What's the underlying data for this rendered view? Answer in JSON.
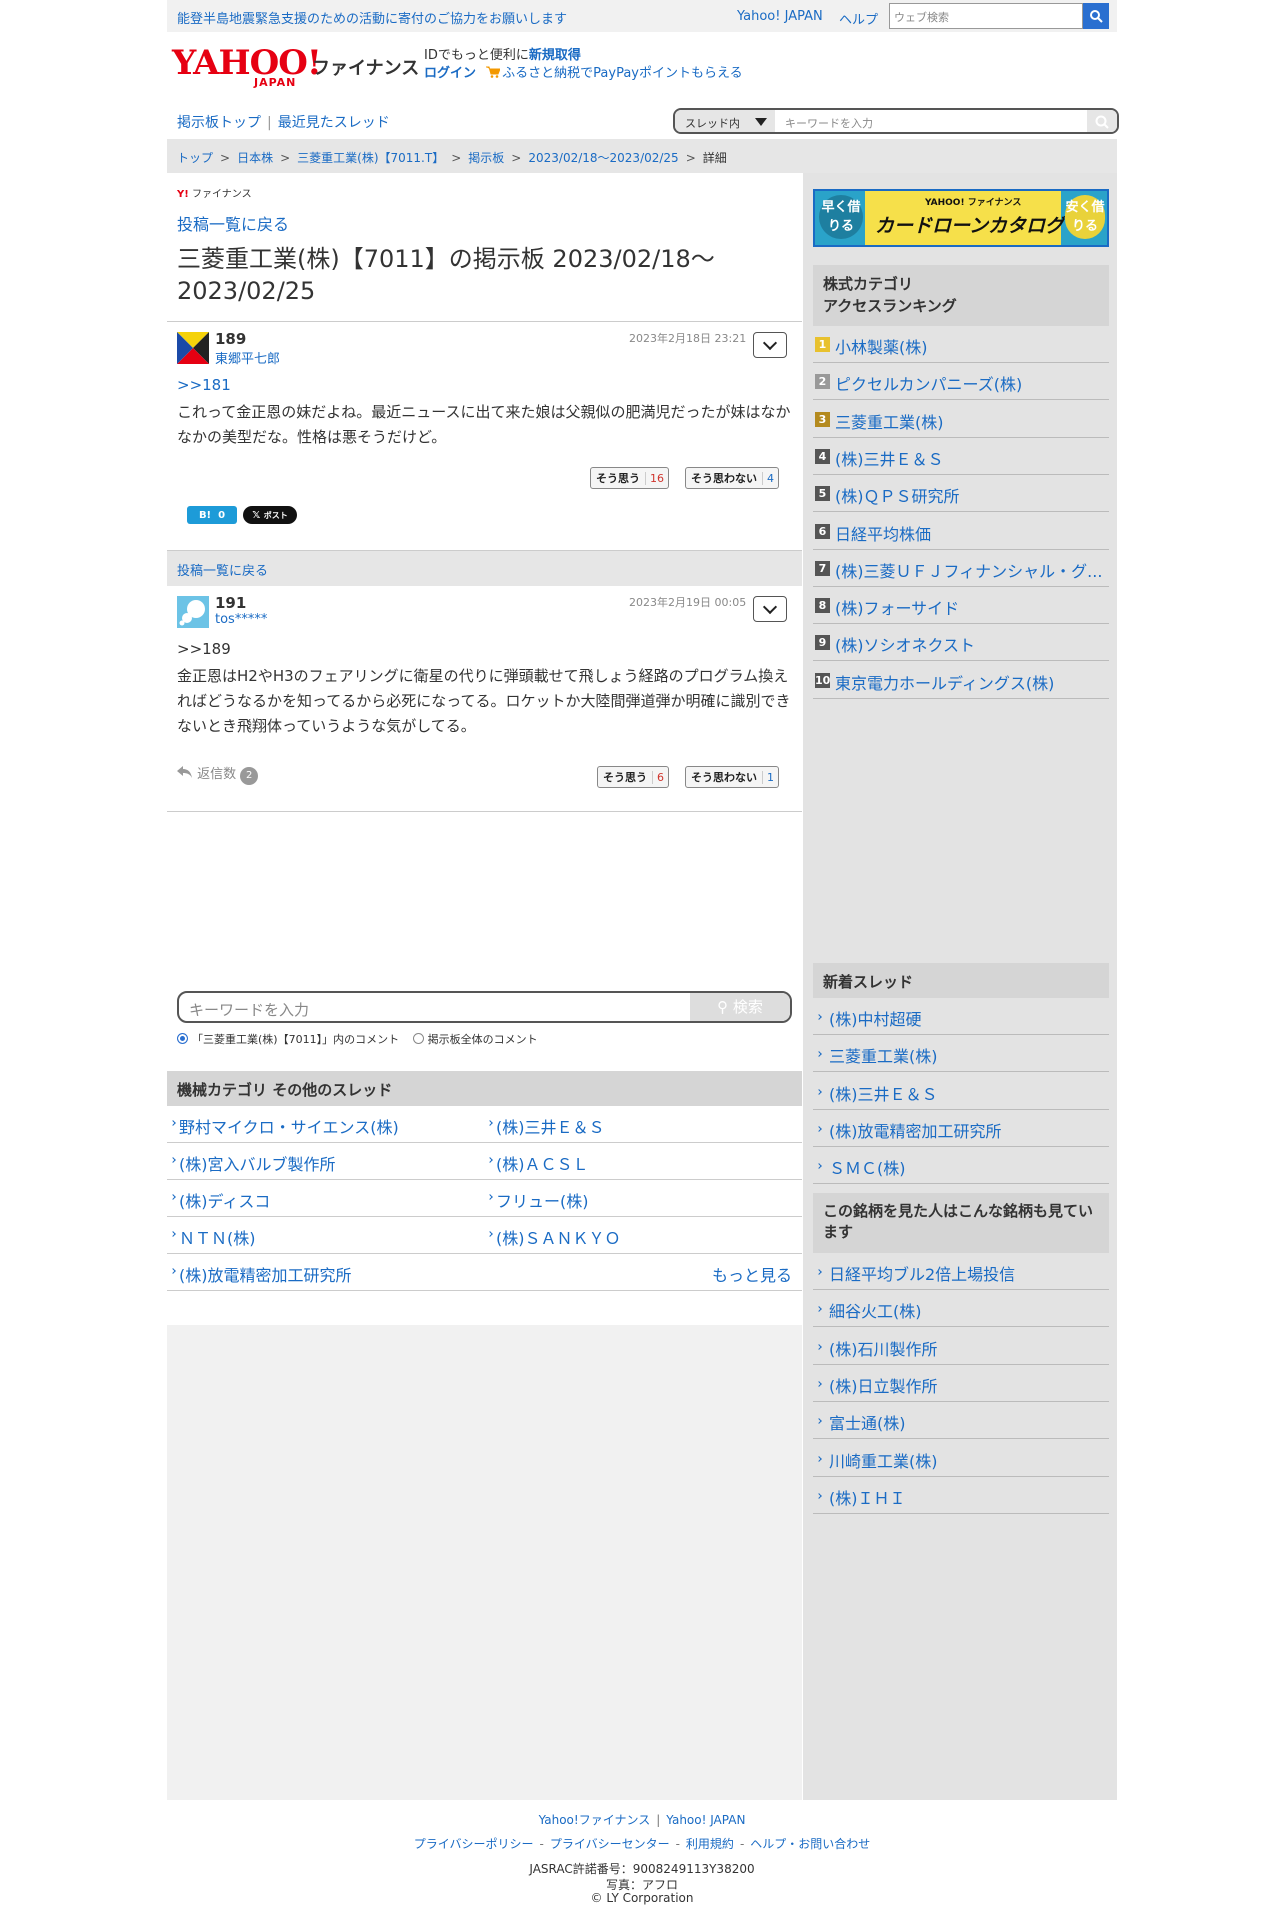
{
  "topbar": {
    "message": "能登半島地震緊急支援のための活動に寄付のご協力をお願いします",
    "yahoo_japan": "Yahoo! JAPAN",
    "help": "ヘルプ",
    "web_search_placeholder": "ウェブ検索"
  },
  "header": {
    "logo_yahoo": "YAHOO!",
    "logo_japan": "JAPAN",
    "logo_finance": "ファイナンス",
    "id_text": "IDでもっと便利に",
    "register": "新規取得",
    "login": "ログイン",
    "furusato": "ふるさと納税でPayPayポイントもらえる"
  },
  "nav": {
    "board_top": "掲示板トップ",
    "recent_threads": "最近見たスレッド",
    "search_scope": "スレッド内",
    "search_placeholder": "キーワードを入力"
  },
  "breadcrumb": [
    "トップ",
    "日本株",
    "三菱重工業(株)【7011.T】",
    "掲示板",
    "2023/02/18〜2023/02/25",
    "詳細"
  ],
  "main": {
    "mini_logo": "ファイナンス",
    "back_to_list": "投稿一覧に戻る",
    "title": "三菱重工業(株)【7011】の掲示板 2023/02/18〜2023/02/25"
  },
  "posts": [
    {
      "number": "189",
      "user": "東郷平七郎",
      "date": "2023年2月18日 23:21",
      "reply_to": ">>181",
      "body": "これって金正恩の妹だよね。最近ニュースに出て来た娘は父親似の肥満児だったが妹はなかなかの美型だな。性格は悪そうだけど。",
      "agree_label": "そう思う",
      "agree_count": "16",
      "disagree_label": "そう思わない",
      "disagree_count": "4",
      "hatena_label": "B!",
      "hatena_count": "0",
      "x_label": "ポスト"
    },
    {
      "number": "191",
      "user": "tos*****",
      "date": "2023年2月19日 00:05",
      "reply_to": ">>189",
      "body": "金正恩はH2やH3のフェアリングに衛星の代りに弾頭載せて飛しょう経路のプログラム換えればどうなるかを知ってるから必死になってる。ロケットか大陸間弾道弾か明確に識別できないとき飛翔体っていうような気がしてる。",
      "reply_count_label": "返信数",
      "reply_count": "2",
      "agree_label": "そう思う",
      "agree_count": "6",
      "disagree_label": "そう思わない",
      "disagree_count": "1"
    }
  ],
  "bottom_search": {
    "placeholder": "キーワードを入力",
    "button": "検索",
    "option_thread": "「三菱重工業(株)【7011】」内のコメント",
    "option_all": "掲示板全体のコメント"
  },
  "other_threads": {
    "heading": "機械カテゴリ その他のスレッド",
    "items": [
      "野村マイクロ・サイエンス(株)",
      "(株)三井Ｅ＆Ｓ",
      "(株)宮入バルブ製作所",
      "(株)ＡＣＳＬ",
      "(株)ディスコ",
      "フリュー(株)",
      "ＮＴＮ(株)",
      "(株)ＳＡＮＫＹＯ",
      "(株)放電精密加工研究所"
    ],
    "more": "もっと見る"
  },
  "banner": {
    "left": "早く借りる",
    "right": "安く借りる",
    "top": "YAHOO! ファイナンス",
    "main": "カードローンカタログ"
  },
  "ranking": {
    "heading_line1": "株式カテゴリ",
    "heading_line2": "アクセスランキング",
    "items": [
      "小林製薬(株)",
      "ピクセルカンパニーズ(株)",
      "三菱重工業(株)",
      "(株)三井Ｅ＆Ｓ",
      "(株)ＱＰＳ研究所",
      "日経平均株価",
      "(株)三菱ＵＦＪフィナンシャル・グ...",
      "(株)フォーサイド",
      "(株)ソシオネクスト",
      "東京電力ホールディングス(株)"
    ],
    "ranks": [
      "1",
      "2",
      "3",
      "4",
      "5",
      "6",
      "7",
      "8",
      "9",
      "10"
    ]
  },
  "new_threads": {
    "heading": "新着スレッド",
    "items": [
      "(株)中村超硬",
      "三菱重工業(株)",
      "(株)三井Ｅ＆Ｓ",
      "(株)放電精密加工研究所",
      "ＳＭＣ(株)"
    ]
  },
  "also_viewed": {
    "heading": "この銘柄を見た人はこんな銘柄も見ています",
    "items": [
      "日経平均ブル2倍上場投信",
      "細谷火工(株)",
      "(株)石川製作所",
      "(株)日立製作所",
      "富士通(株)",
      "川崎重工業(株)",
      "(株)ＩＨＩ"
    ]
  },
  "footer": {
    "finance": "Yahoo!ファイナンス",
    "yahoo_japan": "Yahoo! JAPAN",
    "privacy_policy": "プライバシーポリシー",
    "privacy_center": "プライバシーセンター",
    "terms": "利用規約",
    "help_contact": "ヘルプ・お問い合わせ",
    "jasrac": "JASRAC許諾番号：9008249113Y38200",
    "photo": "写真：アフロ",
    "copyright": "© LY Corporation"
  },
  "colors": {
    "link": "#1a6bc4",
    "brand_red": "#e60012",
    "agree": "#d0342c",
    "disagree": "#1a6bc4"
  }
}
